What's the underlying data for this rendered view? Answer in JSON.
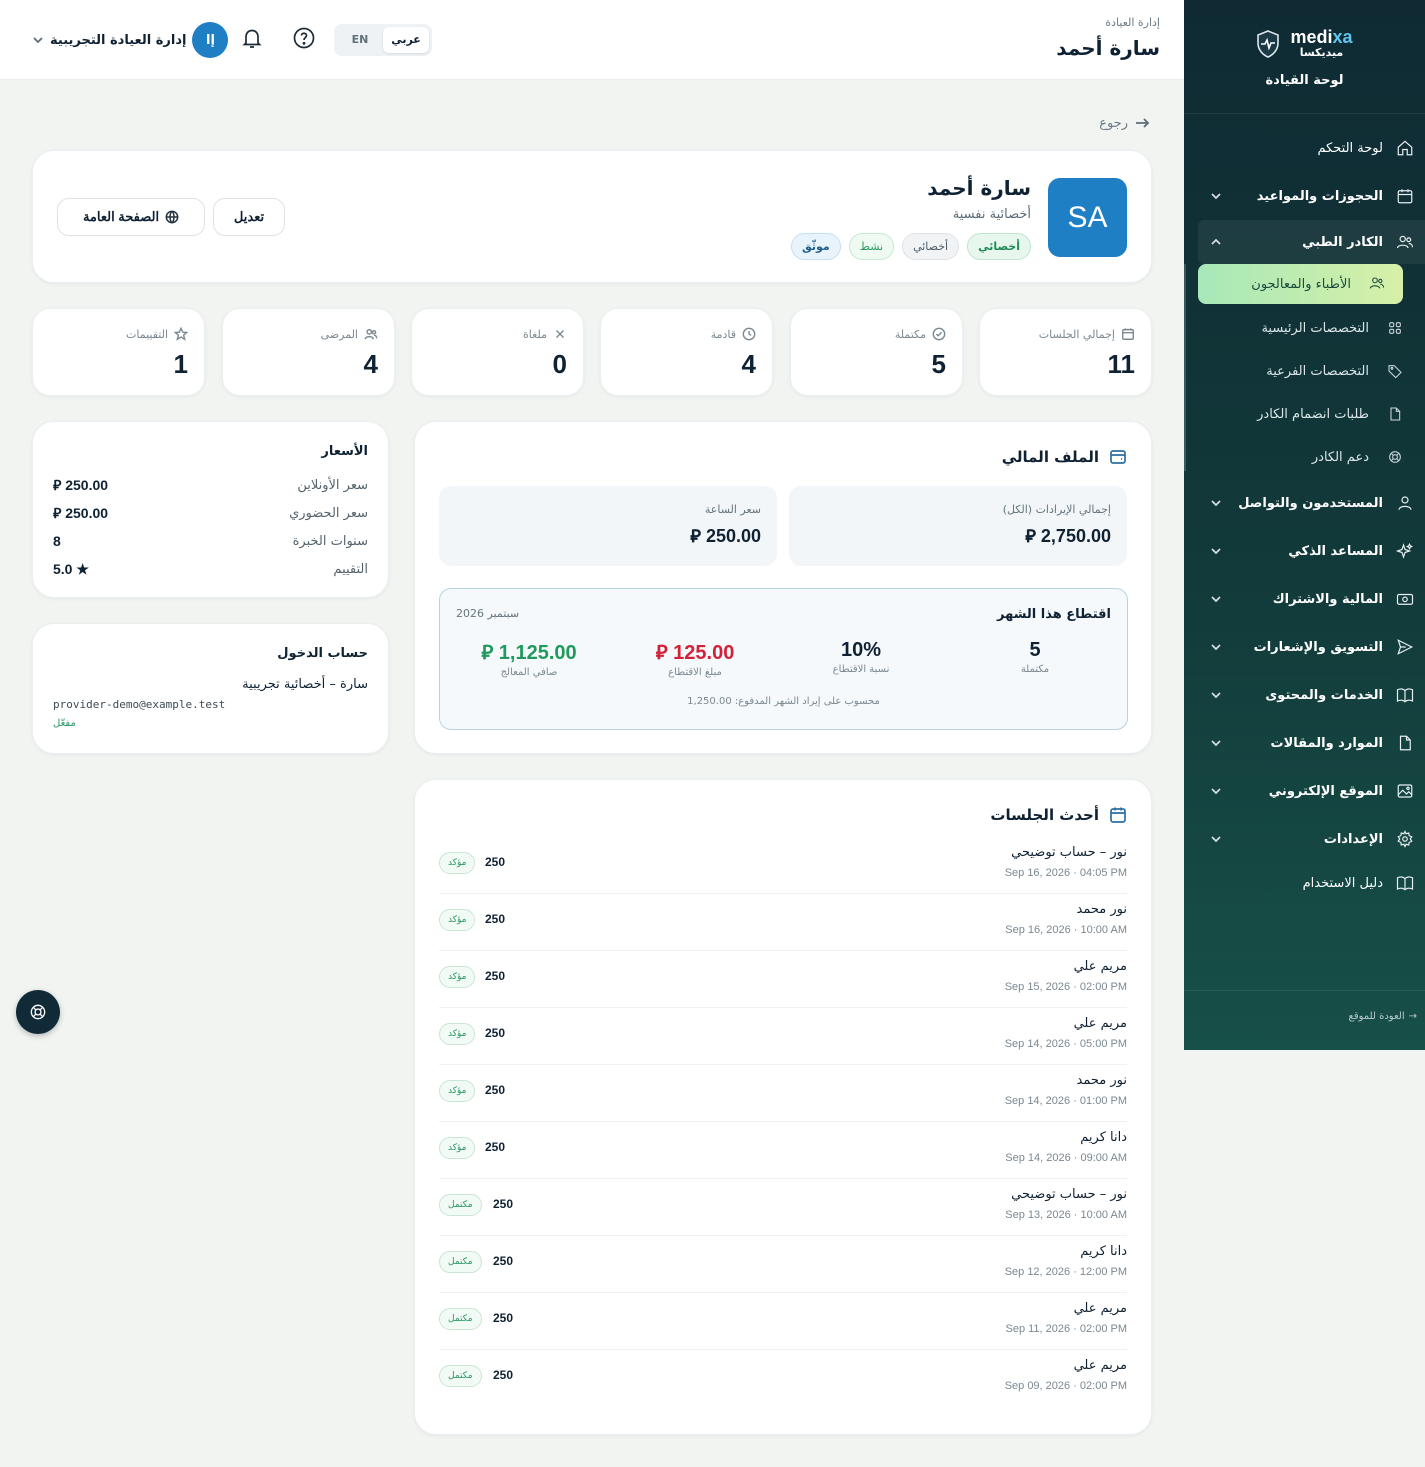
{
  "header": {
    "crumb": "إدارة العيادة",
    "title": "سارة أحمد",
    "lang_ar": "عربي",
    "lang_en": "EN",
    "user_name": "إدارة العيادة التجريبية",
    "user_initials": "إا"
  },
  "sidebar": {
    "brand_name_a": "medi",
    "brand_name_b": "xa",
    "brand_sub": "ميديكسا",
    "panel_title": "لوحة القيادة",
    "items": [
      {
        "label": "لوحة التحكم",
        "icon": "home-icon"
      },
      {
        "label": "الحجوزات والمواعيد",
        "icon": "calendar-icon"
      },
      {
        "label": "الكادر الطبي",
        "icon": "users-icon"
      },
      {
        "label": "المستخدمون والتواصل",
        "icon": "user-icon"
      },
      {
        "label": "المساعد الذكي",
        "icon": "sparkles-icon"
      },
      {
        "label": "المالية والاشتراك",
        "icon": "cash-icon"
      },
      {
        "label": "التسويق والإشعارات",
        "icon": "send-icon"
      },
      {
        "label": "الخدمات والمحتوى",
        "icon": "book-icon"
      },
      {
        "label": "الموارد والمقالات",
        "icon": "file-icon"
      },
      {
        "label": "الموقع الإلكتروني",
        "icon": "image-icon"
      },
      {
        "label": "الإعدادات",
        "icon": "gear-icon"
      },
      {
        "label": "دليل الاستخدام",
        "icon": "book-open-icon"
      }
    ],
    "sub_items": [
      {
        "label": "الأطباء والمعالجون",
        "icon": "users-icon"
      },
      {
        "label": "التخصصات الرئيسية",
        "icon": "grid-icon"
      },
      {
        "label": "التخصصات الفرعية",
        "icon": "tag-icon"
      },
      {
        "label": "طلبات انضمام الكادر",
        "icon": "file-icon"
      },
      {
        "label": "دعم الكادر",
        "icon": "lifebuoy-icon"
      }
    ],
    "back_to_site": "العودة للموقع"
  },
  "main": {
    "back": "رجوع",
    "profile": {
      "initials": "SA",
      "name": "سارة أحمد",
      "role": "أخصائية نفسية",
      "badges": [
        "أخصائي",
        "أخصائي",
        "نشط",
        "موثّق"
      ],
      "edit_label": "تعديل",
      "public_label": "الصفحة العامة"
    },
    "stats": [
      {
        "label": "إجمالي الجلسات",
        "value": "11",
        "icon": "calendar-icon"
      },
      {
        "label": "مكتملة",
        "value": "5",
        "icon": "check-circle-icon"
      },
      {
        "label": "قادمة",
        "value": "4",
        "icon": "clock-icon"
      },
      {
        "label": "ملغاة",
        "value": "0",
        "icon": "x-icon"
      },
      {
        "label": "المرضى",
        "value": "4",
        "icon": "users-icon"
      },
      {
        "label": "التقييمات",
        "value": "1",
        "icon": "star-icon"
      }
    ],
    "finance": {
      "title": "الملف المالي",
      "total_revenue_label": "إجمالي الإيرادات (الكل)",
      "total_revenue": "2,750.00",
      "hourly_label": "سعر الساعة",
      "hourly": "250.00",
      "month_title": "اقتطاع هذا الشهر",
      "month_date": "سبتمبر 2026",
      "completed": "5",
      "completed_label": "مكتملة",
      "rate": "10%",
      "rate_label": "نسبة الاقتطاع",
      "cut": "125.00",
      "cut_label": "مبلغ الاقتطاع",
      "net": "1,125.00",
      "net_label": "صافي المعالج",
      "note": "محسوب على إيراد الشهر المدفوع: 1,250.00"
    },
    "prices": {
      "title": "الأسعار",
      "rows": [
        {
          "k": "سعر الأونلاين",
          "v": "250.00"
        },
        {
          "k": "سعر الحضوري",
          "v": "250.00"
        },
        {
          "k": "سنوات الخبرة",
          "v": "8"
        },
        {
          "k": "التقييم",
          "v": "★ 5.0"
        }
      ]
    },
    "login": {
      "title": "حساب الدخول",
      "name": "سارة – أخصائية تجريبية",
      "email": "provider-demo@example.test",
      "status": "مفعّل"
    },
    "sessions": {
      "title": "أحدث الجلسات",
      "rows": [
        {
          "name": "نور – حساب توضيحي",
          "date": "Sep 16, 2026 · 04:05 PM",
          "amount": "250",
          "status": "مؤكد"
        },
        {
          "name": "نور محمد",
          "date": "Sep 16, 2026 · 10:00 AM",
          "amount": "250",
          "status": "مؤكد"
        },
        {
          "name": "مريم علي",
          "date": "Sep 15, 2026 · 02:00 PM",
          "amount": "250",
          "status": "مؤكد"
        },
        {
          "name": "مريم علي",
          "date": "Sep 14, 2026 · 05:00 PM",
          "amount": "250",
          "status": "مؤكد"
        },
        {
          "name": "نور محمد",
          "date": "Sep 14, 2026 · 01:00 PM",
          "amount": "250",
          "status": "مؤكد"
        },
        {
          "name": "دانا كريم",
          "date": "Sep 14, 2026 · 09:00 AM",
          "amount": "250",
          "status": "مؤكد"
        },
        {
          "name": "نور – حساب توضيحي",
          "date": "Sep 13, 2026 · 10:00 AM",
          "amount": "250",
          "status": "مكتمل"
        },
        {
          "name": "دانا كريم",
          "date": "Sep 12, 2026 · 12:00 PM",
          "amount": "250",
          "status": "مكتمل"
        },
        {
          "name": "مريم علي",
          "date": "Sep 11, 2026 · 02:00 PM",
          "amount": "250",
          "status": "مكتمل"
        },
        {
          "name": "مريم علي",
          "date": "Sep 09, 2026 · 02:00 PM",
          "amount": "250",
          "status": "مكتمل"
        }
      ]
    }
  },
  "colors": {
    "accent": "#1e7fc4",
    "sidebar": "#0f2a33",
    "cut": "#d2223a",
    "net": "#1f9a5c"
  }
}
